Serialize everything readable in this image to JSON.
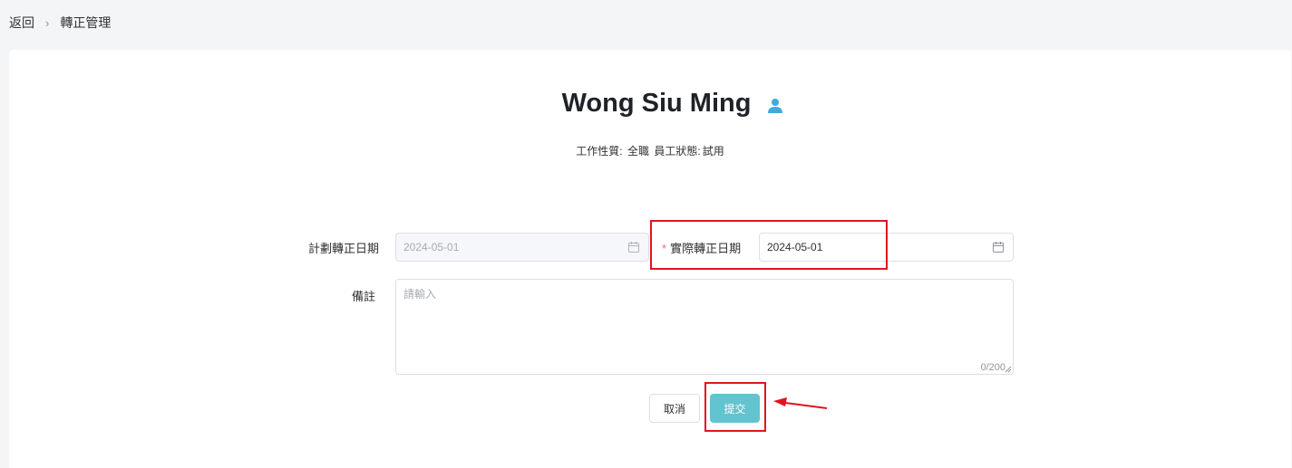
{
  "breadcrumb": {
    "back": "返回",
    "separator": "›",
    "current": "轉正管理"
  },
  "employee": {
    "name": "Wong Siu Ming",
    "work_nature_label": "工作性質:",
    "work_nature_value": "全職",
    "status_label": "員工狀態:",
    "status_value": "試用"
  },
  "form": {
    "planned_date_label": "計劃轉正日期",
    "planned_date_value": "2024-05-01",
    "actual_date_required": "*",
    "actual_date_label": "實際轉正日期",
    "actual_date_value": "2024-05-01",
    "remark_label": "備註",
    "remark_placeholder": "請輸入",
    "remark_counter": "0/200"
  },
  "buttons": {
    "cancel": "取消",
    "submit": "提交"
  },
  "colors": {
    "accent": "#63c3ce",
    "icon": "#3fa9e0",
    "highlight": "#e0141e",
    "required": "#f56c6c"
  },
  "icons": [
    "person-icon",
    "calendar-icon",
    "arrow-annotation"
  ]
}
